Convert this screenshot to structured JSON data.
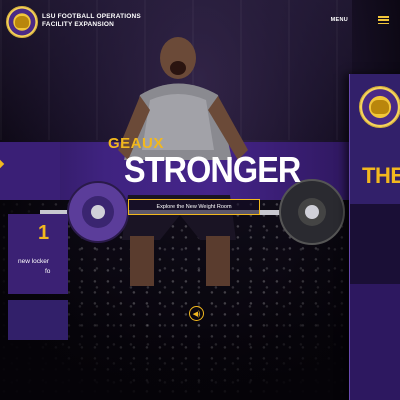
{
  "header": {
    "org_line1": "LSU FOOTBALL OPERATIONS",
    "org_line2": "FACILITY EXPANSION",
    "menu_label": "MENU"
  },
  "hero": {
    "kicker": "GEAUX",
    "headline": "STRONGER",
    "cta_label": "Explore the New Weight Room"
  },
  "side_card": {
    "heading": "THE",
    "number": "1",
    "text_line1": "new locker",
    "text_line2": "fo"
  },
  "colors": {
    "gold": "#f2b81e",
    "purple": "#3f2380",
    "dark": "#0a0610"
  },
  "icons": [
    "lsu-tiger-logo",
    "menu-hamburger-icon",
    "sound-icon",
    "left-arrow-icon"
  ]
}
